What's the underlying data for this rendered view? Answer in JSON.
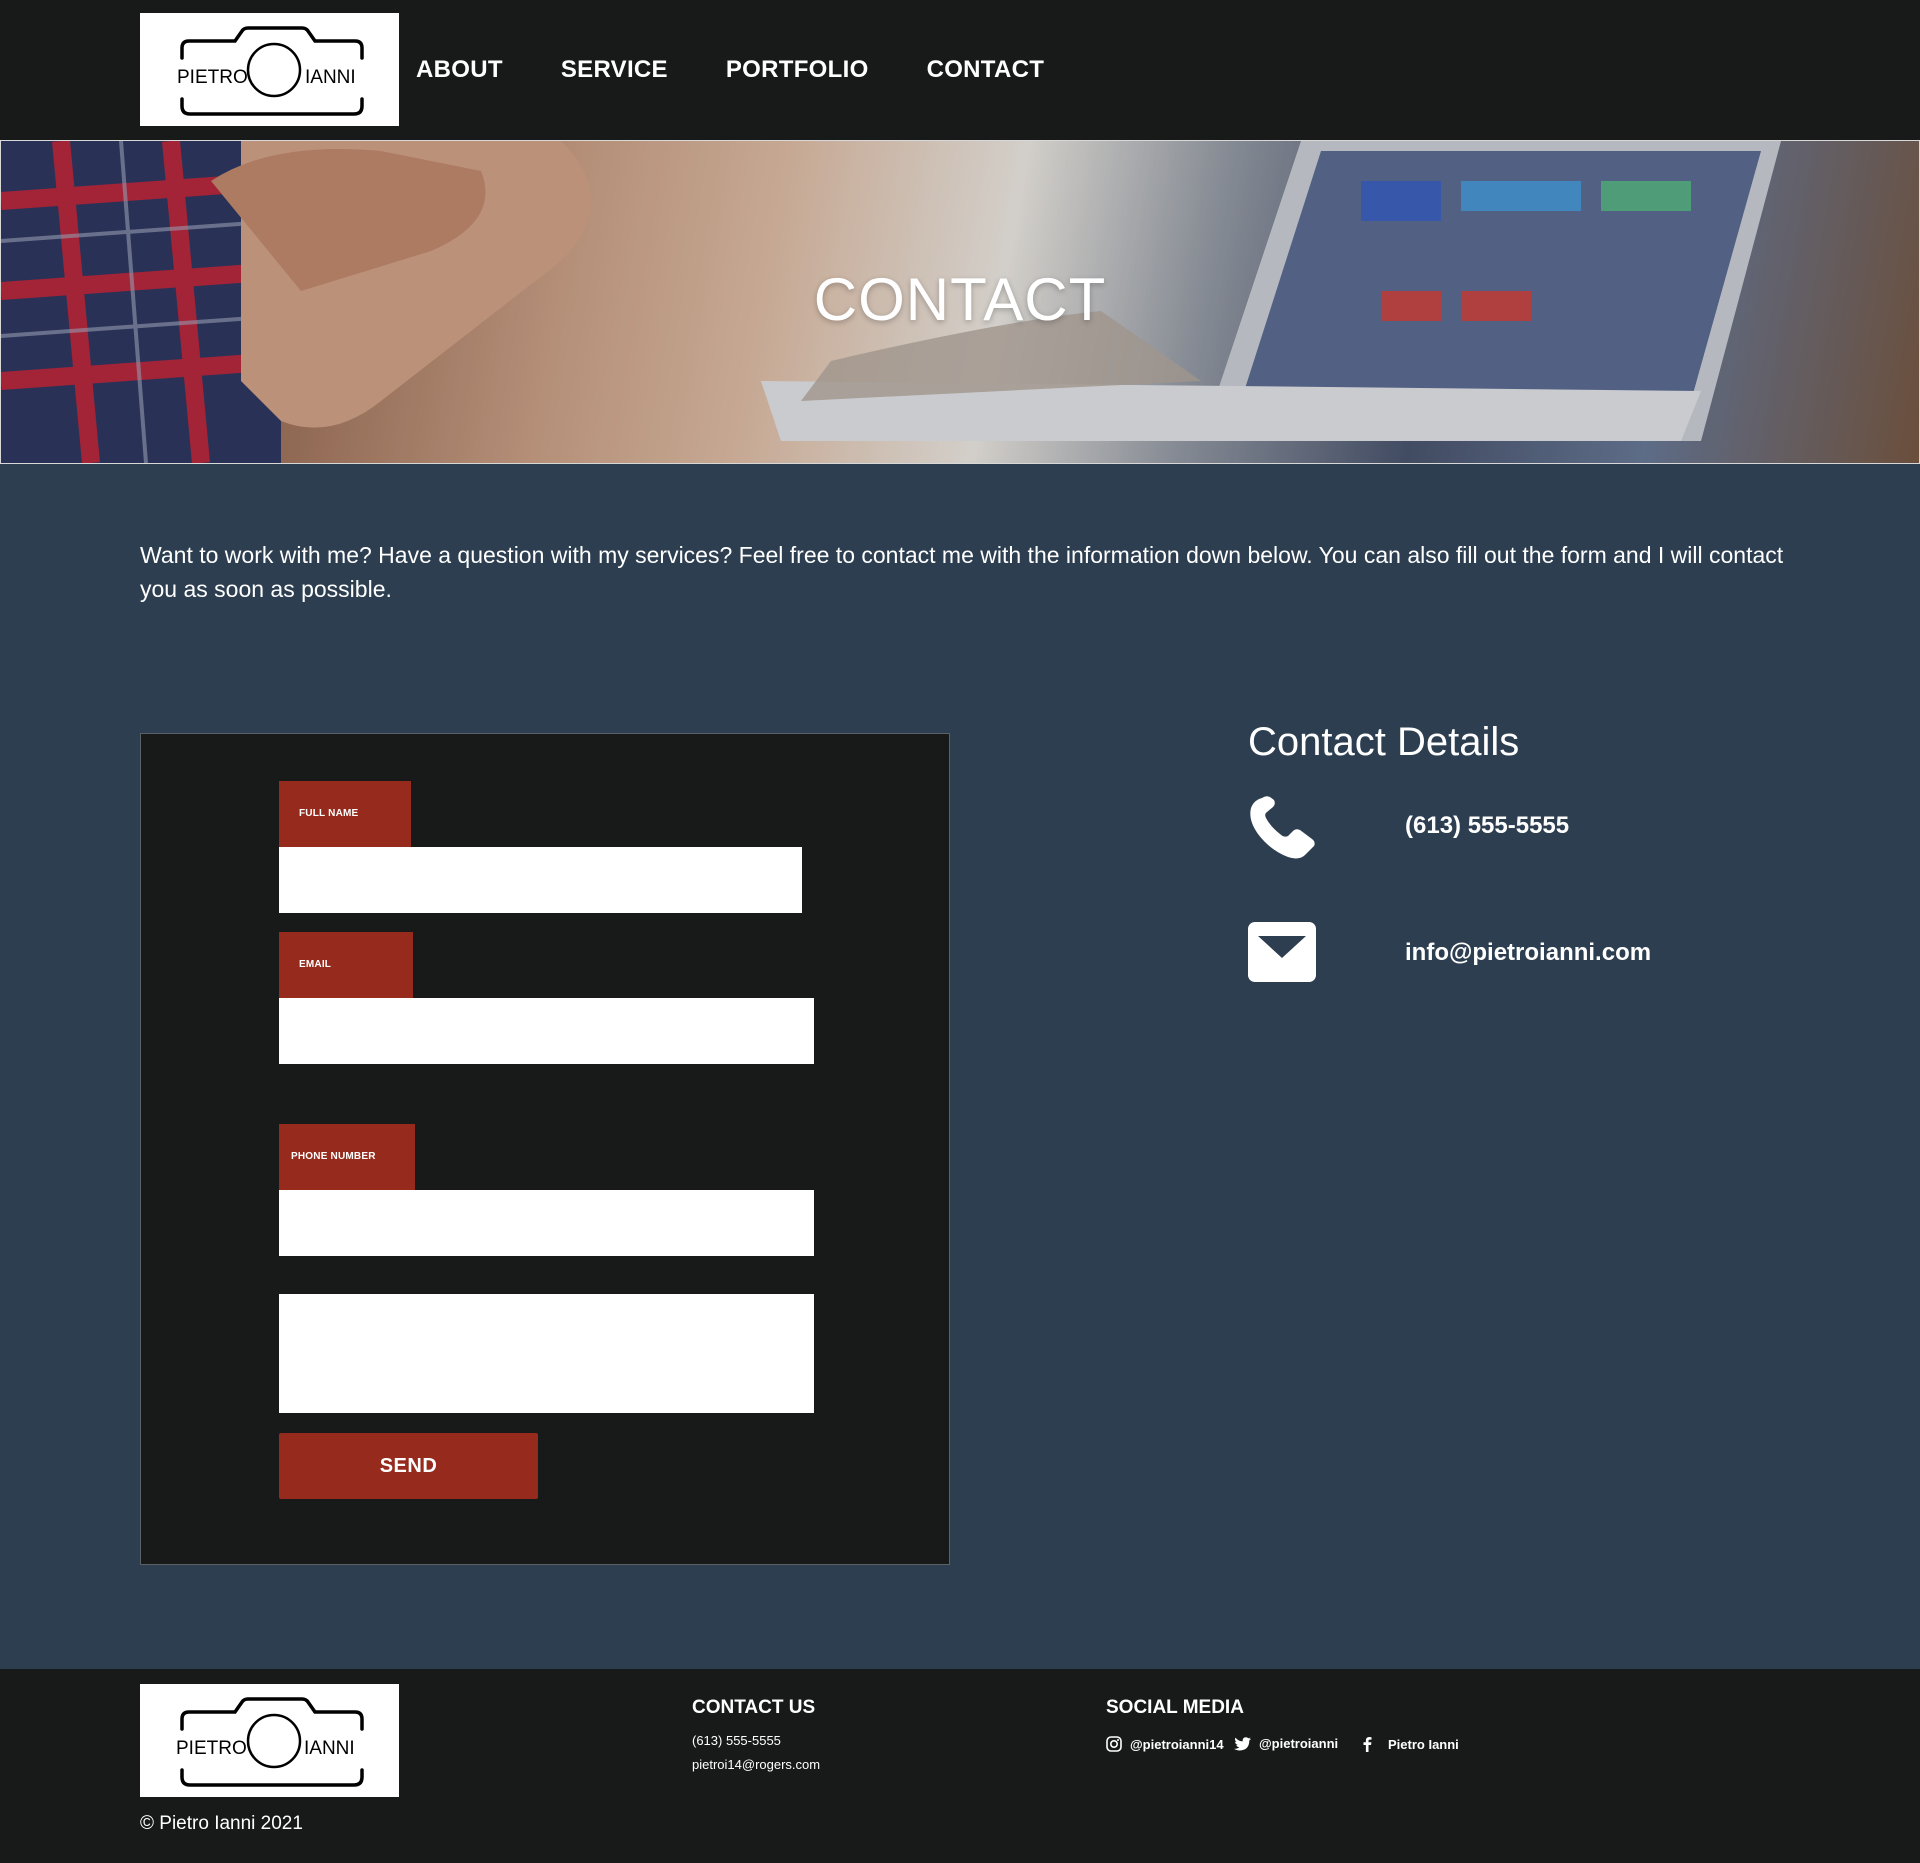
{
  "logo": {
    "left_text": "PIETRO",
    "right_text": "IANNI"
  },
  "nav": {
    "about": "ABOUT",
    "service": "SERVICE",
    "portfolio": "PORTFOLIO",
    "contact": "CONTACT"
  },
  "hero": {
    "title": "CONTACT"
  },
  "intro": "Want to work with me? Have a question with my services? Feel free to contact me with the information down below. You can also fill out the form and I will contact you as soon as possible.",
  "form": {
    "full_name_label": "FULL NAME",
    "email_label": "EMAIL",
    "phone_label": "PHONE NUMBER",
    "full_name_value": "",
    "email_value": "",
    "phone_value": "",
    "message_value": "",
    "send_label": "SEND"
  },
  "details": {
    "title": "Contact Details",
    "phone": "(613) 555-5555",
    "email": "info@pietroianni.com"
  },
  "footer": {
    "copyright": "© Pietro Ianni 2021",
    "contact_heading": "CONTACT US",
    "contact_phone": "(613) 555-5555",
    "contact_email": "pietroi14@rogers.com",
    "social_heading": "SOCIAL MEDIA",
    "instagram": "@pietroianni14",
    "twitter": "@pietroianni",
    "facebook": "Pietro Ianni"
  },
  "colors": {
    "page_bg": "#2c3e50",
    "dark_bg": "#181a1a",
    "accent_red": "#952a1d",
    "text": "#ffffff"
  },
  "icons": {
    "phone": "phone-icon",
    "mail": "mail-icon",
    "instagram": "instagram-icon",
    "twitter": "twitter-icon",
    "facebook": "facebook-icon",
    "logo": "camera-logo"
  }
}
